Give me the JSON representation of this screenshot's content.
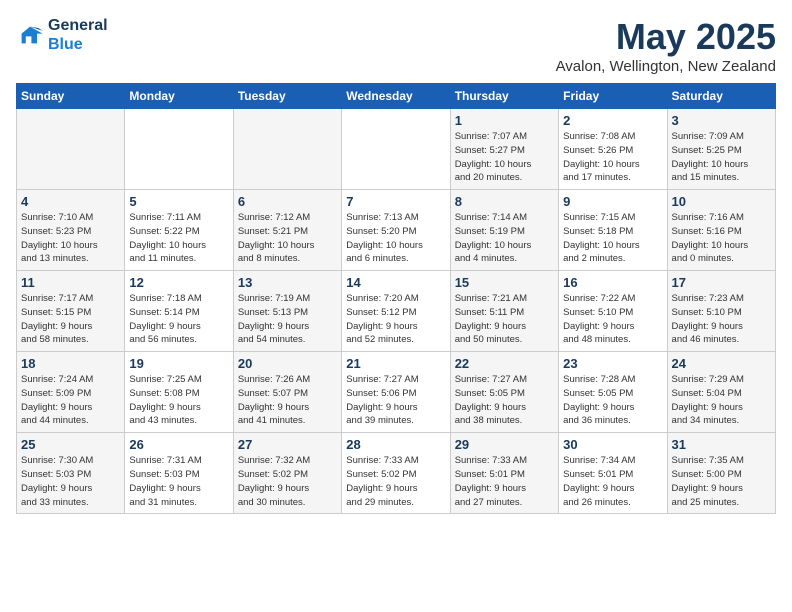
{
  "header": {
    "logo_line1": "General",
    "logo_line2": "Blue",
    "month": "May 2025",
    "location": "Avalon, Wellington, New Zealand"
  },
  "weekdays": [
    "Sunday",
    "Monday",
    "Tuesday",
    "Wednesday",
    "Thursday",
    "Friday",
    "Saturday"
  ],
  "weeks": [
    [
      {
        "day": "",
        "info": ""
      },
      {
        "day": "",
        "info": ""
      },
      {
        "day": "",
        "info": ""
      },
      {
        "day": "",
        "info": ""
      },
      {
        "day": "1",
        "info": "Sunrise: 7:07 AM\nSunset: 5:27 PM\nDaylight: 10 hours\nand 20 minutes."
      },
      {
        "day": "2",
        "info": "Sunrise: 7:08 AM\nSunset: 5:26 PM\nDaylight: 10 hours\nand 17 minutes."
      },
      {
        "day": "3",
        "info": "Sunrise: 7:09 AM\nSunset: 5:25 PM\nDaylight: 10 hours\nand 15 minutes."
      }
    ],
    [
      {
        "day": "4",
        "info": "Sunrise: 7:10 AM\nSunset: 5:23 PM\nDaylight: 10 hours\nand 13 minutes."
      },
      {
        "day": "5",
        "info": "Sunrise: 7:11 AM\nSunset: 5:22 PM\nDaylight: 10 hours\nand 11 minutes."
      },
      {
        "day": "6",
        "info": "Sunrise: 7:12 AM\nSunset: 5:21 PM\nDaylight: 10 hours\nand 8 minutes."
      },
      {
        "day": "7",
        "info": "Sunrise: 7:13 AM\nSunset: 5:20 PM\nDaylight: 10 hours\nand 6 minutes."
      },
      {
        "day": "8",
        "info": "Sunrise: 7:14 AM\nSunset: 5:19 PM\nDaylight: 10 hours\nand 4 minutes."
      },
      {
        "day": "9",
        "info": "Sunrise: 7:15 AM\nSunset: 5:18 PM\nDaylight: 10 hours\nand 2 minutes."
      },
      {
        "day": "10",
        "info": "Sunrise: 7:16 AM\nSunset: 5:16 PM\nDaylight: 10 hours\nand 0 minutes."
      }
    ],
    [
      {
        "day": "11",
        "info": "Sunrise: 7:17 AM\nSunset: 5:15 PM\nDaylight: 9 hours\nand 58 minutes."
      },
      {
        "day": "12",
        "info": "Sunrise: 7:18 AM\nSunset: 5:14 PM\nDaylight: 9 hours\nand 56 minutes."
      },
      {
        "day": "13",
        "info": "Sunrise: 7:19 AM\nSunset: 5:13 PM\nDaylight: 9 hours\nand 54 minutes."
      },
      {
        "day": "14",
        "info": "Sunrise: 7:20 AM\nSunset: 5:12 PM\nDaylight: 9 hours\nand 52 minutes."
      },
      {
        "day": "15",
        "info": "Sunrise: 7:21 AM\nSunset: 5:11 PM\nDaylight: 9 hours\nand 50 minutes."
      },
      {
        "day": "16",
        "info": "Sunrise: 7:22 AM\nSunset: 5:10 PM\nDaylight: 9 hours\nand 48 minutes."
      },
      {
        "day": "17",
        "info": "Sunrise: 7:23 AM\nSunset: 5:10 PM\nDaylight: 9 hours\nand 46 minutes."
      }
    ],
    [
      {
        "day": "18",
        "info": "Sunrise: 7:24 AM\nSunset: 5:09 PM\nDaylight: 9 hours\nand 44 minutes."
      },
      {
        "day": "19",
        "info": "Sunrise: 7:25 AM\nSunset: 5:08 PM\nDaylight: 9 hours\nand 43 minutes."
      },
      {
        "day": "20",
        "info": "Sunrise: 7:26 AM\nSunset: 5:07 PM\nDaylight: 9 hours\nand 41 minutes."
      },
      {
        "day": "21",
        "info": "Sunrise: 7:27 AM\nSunset: 5:06 PM\nDaylight: 9 hours\nand 39 minutes."
      },
      {
        "day": "22",
        "info": "Sunrise: 7:27 AM\nSunset: 5:05 PM\nDaylight: 9 hours\nand 38 minutes."
      },
      {
        "day": "23",
        "info": "Sunrise: 7:28 AM\nSunset: 5:05 PM\nDaylight: 9 hours\nand 36 minutes."
      },
      {
        "day": "24",
        "info": "Sunrise: 7:29 AM\nSunset: 5:04 PM\nDaylight: 9 hours\nand 34 minutes."
      }
    ],
    [
      {
        "day": "25",
        "info": "Sunrise: 7:30 AM\nSunset: 5:03 PM\nDaylight: 9 hours\nand 33 minutes."
      },
      {
        "day": "26",
        "info": "Sunrise: 7:31 AM\nSunset: 5:03 PM\nDaylight: 9 hours\nand 31 minutes."
      },
      {
        "day": "27",
        "info": "Sunrise: 7:32 AM\nSunset: 5:02 PM\nDaylight: 9 hours\nand 30 minutes."
      },
      {
        "day": "28",
        "info": "Sunrise: 7:33 AM\nSunset: 5:02 PM\nDaylight: 9 hours\nand 29 minutes."
      },
      {
        "day": "29",
        "info": "Sunrise: 7:33 AM\nSunset: 5:01 PM\nDaylight: 9 hours\nand 27 minutes."
      },
      {
        "day": "30",
        "info": "Sunrise: 7:34 AM\nSunset: 5:01 PM\nDaylight: 9 hours\nand 26 minutes."
      },
      {
        "day": "31",
        "info": "Sunrise: 7:35 AM\nSunset: 5:00 PM\nDaylight: 9 hours\nand 25 minutes."
      }
    ]
  ]
}
